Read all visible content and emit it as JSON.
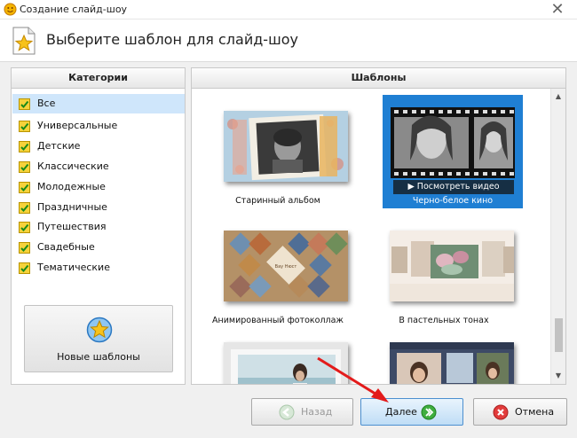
{
  "window": {
    "title": "Создание слайд-шоу",
    "close_glyph": "✕"
  },
  "header": {
    "title": "Выберите шаблон для слайд-шоу",
    "icon": "star-document-icon"
  },
  "categories": {
    "heading": "Категории",
    "selected_index": 0,
    "items": [
      {
        "label": "Все"
      },
      {
        "label": "Универсальные"
      },
      {
        "label": "Детские"
      },
      {
        "label": "Классические"
      },
      {
        "label": "Молодежные"
      },
      {
        "label": "Праздничные"
      },
      {
        "label": "Путешествия"
      },
      {
        "label": "Свадебные"
      },
      {
        "label": "Тематические"
      }
    ],
    "new_templates_button": "Новые шаблоны"
  },
  "templates": {
    "heading": "Шаблоны",
    "items": [
      {
        "name": "Старинный альбом",
        "selected": false
      },
      {
        "name": "Черно-белое кино",
        "selected": true,
        "preview_label": "Посмотреть видео"
      },
      {
        "name": "Анимированный фотоколлаж",
        "selected": false,
        "thumb_text": "Вау Нюст"
      },
      {
        "name": "В пастельных тонах",
        "selected": false
      },
      {
        "name": "",
        "selected": false
      },
      {
        "name": "",
        "selected": false
      }
    ],
    "scroll_fraction": 0.8
  },
  "footer": {
    "back_label": "Назад",
    "next_label": "Далее",
    "cancel_label": "Отмена"
  },
  "colors": {
    "accent": "#1f7fd3",
    "next_button": "#bfddf6",
    "arrow": "#e31b1b"
  }
}
